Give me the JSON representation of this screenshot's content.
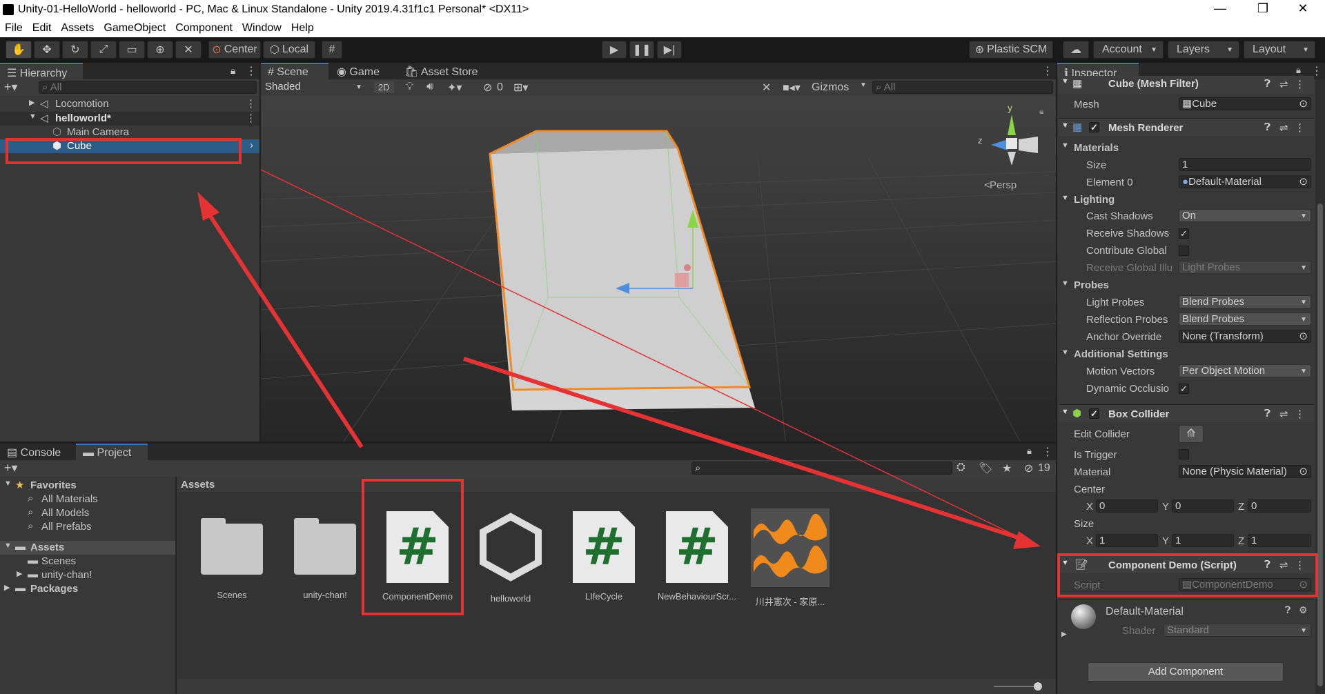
{
  "window": {
    "title": "Unity-01-HelloWorld - helloworld - PC, Mac & Linux Standalone - Unity 2019.4.31f1c1 Personal* <DX11>",
    "minimize": "—",
    "restore": "❐",
    "close": "✕"
  },
  "menu": [
    "File",
    "Edit",
    "Assets",
    "GameObject",
    "Component",
    "Window",
    "Help"
  ],
  "toolbar": {
    "center_label": "Center",
    "local_label": "Local",
    "plastic_label": "Plastic SCM",
    "account_label": "Account",
    "layers_label": "Layers",
    "layout_label": "Layout"
  },
  "hierarchy": {
    "tab_label": "Hierarchy",
    "search_placeholder": "All",
    "items": [
      {
        "label": "Locomotion"
      },
      {
        "label": "helloworld*"
      },
      {
        "label": "Main Camera"
      },
      {
        "label": "Cube"
      }
    ]
  },
  "scene": {
    "tabs": [
      "Scene",
      "Game",
      "Asset Store"
    ],
    "shading": "Shaded",
    "mode_2d": "2D",
    "hidden_count": "0",
    "gizmos_label": "Gizmos",
    "search_placeholder": "All",
    "persp_label": "Persp",
    "axis_y": "y",
    "axis_z": "z"
  },
  "project": {
    "tabs": [
      "Console",
      "Project"
    ],
    "hidden_count": "19",
    "favorites_label": "Favorites",
    "favorites": [
      "All Materials",
      "All Models",
      "All Prefabs"
    ],
    "assets_label": "Assets",
    "asset_folders": [
      "Scenes",
      "unity-chan!"
    ],
    "packages_label": "Packages",
    "breadcrumb": "Assets",
    "assets": [
      {
        "name": "Scenes",
        "kind": "folder"
      },
      {
        "name": "unity-chan!",
        "kind": "folder"
      },
      {
        "name": "ComponentDemo",
        "kind": "script"
      },
      {
        "name": "helloworld",
        "kind": "unity"
      },
      {
        "name": "LIfeCycle",
        "kind": "script"
      },
      {
        "name": "NewBehaviourScr...",
        "kind": "script"
      },
      {
        "name": "川井憲次 - 家原...",
        "kind": "audio"
      }
    ]
  },
  "inspector": {
    "tab_label": "Inspector",
    "mesh_filter": {
      "title": "Cube (Mesh Filter)",
      "mesh_label": "Mesh",
      "mesh_value": "Cube"
    },
    "mesh_renderer": {
      "title": "Mesh Renderer",
      "materials_label": "Materials",
      "size_label": "Size",
      "size_value": "1",
      "element0_label": "Element 0",
      "element0_value": "Default-Material",
      "lighting_label": "Lighting",
      "cast_shadows_label": "Cast Shadows",
      "cast_shadows_value": "On",
      "receive_shadows_label": "Receive Shadows",
      "contribute_gi_label": "Contribute Global",
      "receive_gi_label": "Receive Global Illu",
      "receive_gi_value": "Light Probes",
      "probes_label": "Probes",
      "light_probes_label": "Light Probes",
      "light_probes_value": "Blend Probes",
      "reflection_probes_label": "Reflection Probes",
      "reflection_probes_value": "Blend Probes",
      "anchor_override_label": "Anchor Override",
      "anchor_override_value": "None (Transform)",
      "additional_label": "Additional Settings",
      "motion_vectors_label": "Motion Vectors",
      "motion_vectors_value": "Per Object Motion",
      "dynamic_occlusion_label": "Dynamic Occlusio"
    },
    "box_collider": {
      "title": "Box Collider",
      "edit_collider_label": "Edit Collider",
      "is_trigger_label": "Is Trigger",
      "material_label": "Material",
      "material_value": "None (Physic Material)",
      "center_label": "Center",
      "center": {
        "x": "0",
        "y": "0",
        "z": "0"
      },
      "size_label": "Size",
      "size": {
        "x": "1",
        "y": "1",
        "z": "1"
      },
      "x_label": "X",
      "y_label": "Y",
      "z_label": "Z"
    },
    "component_demo": {
      "title": "Component Demo (Script)",
      "script_label": "Script",
      "script_value": "ComponentDemo"
    },
    "material": {
      "name": "Default-Material",
      "shader_label": "Shader",
      "shader_value": "Standard"
    },
    "add_component_label": "Add Component"
  },
  "colors": {
    "accent": "#3a79bb",
    "selection": "#2c5d87",
    "annotation_red": "#e53333",
    "cube_outline": "#f08a24"
  }
}
